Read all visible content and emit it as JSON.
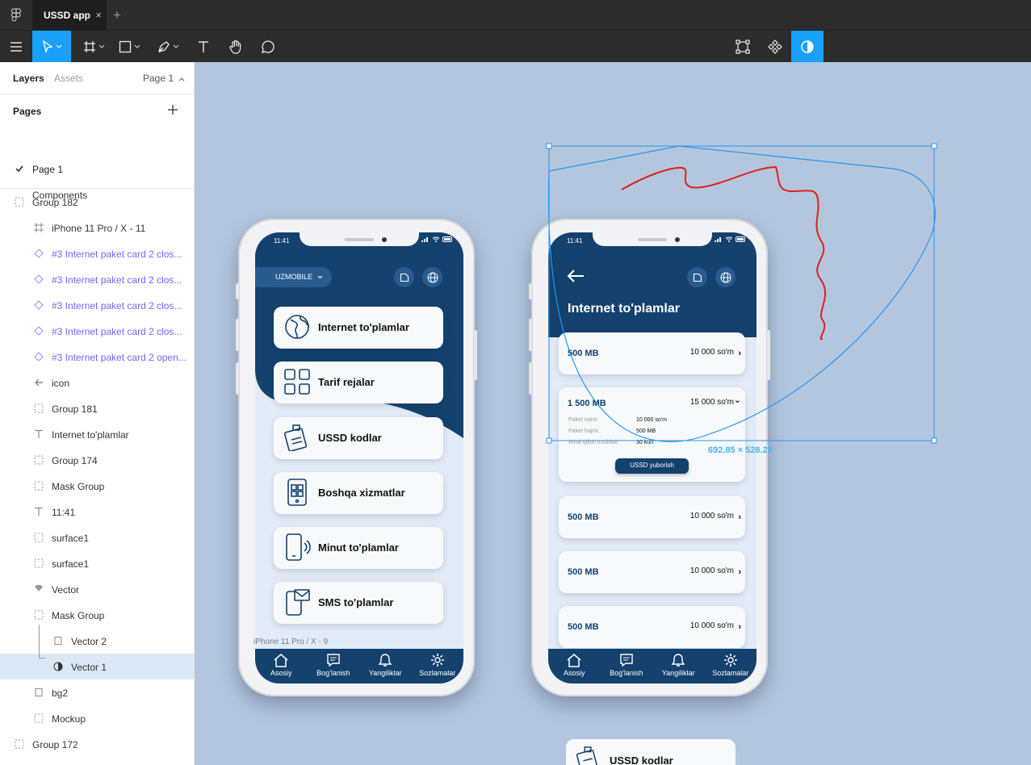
{
  "window": {
    "tab_title": "USSD app",
    "close_glyph": "×",
    "new_tab_glyph": "+"
  },
  "toolbar": {
    "tools": [
      "menu-icon",
      "move-tool",
      "frame-tool",
      "shape-tool",
      "pen-tool",
      "text-tool",
      "hand-tool",
      "comment-tool"
    ],
    "right_tools": [
      "transform-icon",
      "component-icon",
      "mask-icon"
    ],
    "accent": "#18a0fb"
  },
  "left_panel": {
    "tabs": {
      "layers": "Layers",
      "assets": "Assets",
      "page": "Page 1"
    },
    "pages_title": "Pages",
    "pages": [
      "Page 1",
      "Components"
    ],
    "layers": [
      {
        "label": "Group 182",
        "icon": "group-icon"
      },
      {
        "label": "iPhone 11 Pro / X - 11",
        "icon": "frame-icon"
      },
      {
        "label": "#3 Internet paket card 2 clos...",
        "icon": "component-instance-icon"
      },
      {
        "label": "#3 Internet paket card 2 clos...",
        "icon": "component-instance-icon"
      },
      {
        "label": "#3 Internet paket card 2 clos...",
        "icon": "component-instance-icon"
      },
      {
        "label": "#3 Internet paket card 2 clos...",
        "icon": "component-instance-icon"
      },
      {
        "label": "#3 Internet paket card 2 open...",
        "icon": "component-instance-icon"
      },
      {
        "label": "icon",
        "icon": "arrow-icon"
      },
      {
        "label": "Group 181",
        "icon": "group-icon"
      },
      {
        "label": "Internet to'plamlar",
        "icon": "text-icon"
      },
      {
        "label": "Group 174",
        "icon": "group-icon"
      },
      {
        "label": "Mask Group",
        "icon": "group-icon"
      },
      {
        "label": "11:41",
        "icon": "text-icon"
      },
      {
        "label": "surface1",
        "icon": "group-icon"
      },
      {
        "label": "surface1",
        "icon": "group-icon"
      },
      {
        "label": "Vector",
        "icon": "vector-icon"
      },
      {
        "label": "Mask Group",
        "icon": "group-icon"
      },
      {
        "label": "Vector 2",
        "icon": "rectangle-icon"
      },
      {
        "label": "Vector 1",
        "icon": "mask-icon"
      },
      {
        "label": "bg2",
        "icon": "rectangle-icon"
      },
      {
        "label": "Mockup",
        "icon": "group-icon"
      },
      {
        "label": "Group 172",
        "icon": "group-icon"
      }
    ]
  },
  "canvas": {
    "frame_label": "iPhone 11 Pro / X - 9",
    "selection_dims": "692.85 × 528.28",
    "bottom_card": "USSD kodlar",
    "background": "#b4c6de"
  },
  "phone_common": {
    "time": "11:41",
    "nav": [
      "Asosiy",
      "Bog'lanish",
      "Yangiliklar",
      "Sozlamalar"
    ],
    "primary_color": "#14416e"
  },
  "phone1": {
    "operator": "UZMOBILE",
    "menu": [
      "Internet to'plamlar",
      "Tarif rejalar",
      "USSD kodlar",
      "Boshqa xizmatlar",
      "Minut to'plamlar",
      "SMS to'plamlar"
    ]
  },
  "phone2": {
    "title": "Internet to'plamlar",
    "packages": [
      {
        "size": "500 MB",
        "price": "10 000 so'm",
        "chevron": "›"
      },
      {
        "size": "1 500 MB",
        "price": "15 000 so'm",
        "chevron": "⌄"
      },
      {
        "size": "500 MB",
        "price": "10 000 so'm",
        "chevron": "›"
      },
      {
        "size": "500 MB",
        "price": "10 000 so'm",
        "chevron": "›"
      },
      {
        "size": "500 MB",
        "price": "10 000 so'm",
        "chevron": "›"
      }
    ],
    "details": {
      "price_label": "Paket narxi:",
      "price_value": "10 000 so'm",
      "size_label": "Paket hajmi:",
      "size_value": "500 MB",
      "period_label": "Amal qilish muddati:",
      "period_value": "30 kun",
      "button": "USSD yuborish"
    }
  }
}
